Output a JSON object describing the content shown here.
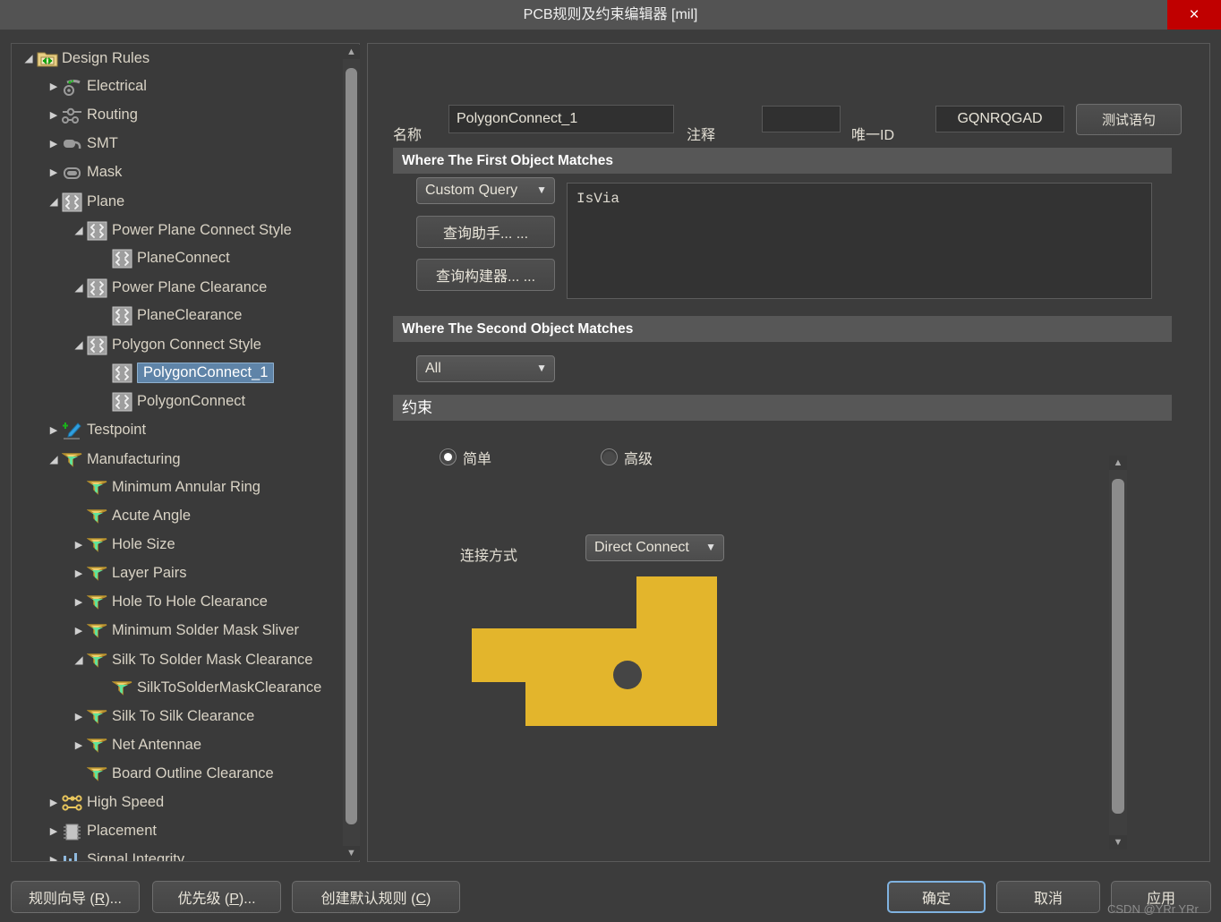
{
  "window": {
    "title": "PCB规则及约束编辑器 [mil]",
    "close_label": "×",
    "close_icon": "close-icon",
    "titlebar_bg": "#535353",
    "close_bg": "#c00000"
  },
  "tree": {
    "root_label": "Design Rules",
    "selected": "PolygonConnect_1",
    "items": [
      {
        "label": "Design Rules",
        "depth": 0,
        "arrow": "open",
        "icon": "folder-rules-icon"
      },
      {
        "label": "Electrical",
        "depth": 1,
        "arrow": "closed",
        "icon": "electrical-icon"
      },
      {
        "label": "Routing",
        "depth": 1,
        "arrow": "closed",
        "icon": "routing-icon"
      },
      {
        "label": "SMT",
        "depth": 1,
        "arrow": "closed",
        "icon": "smt-icon"
      },
      {
        "label": "Mask",
        "depth": 1,
        "arrow": "closed",
        "icon": "mask-icon"
      },
      {
        "label": "Plane",
        "depth": 1,
        "arrow": "open",
        "icon": "plane-icon"
      },
      {
        "label": "Power Plane Connect Style",
        "depth": 2,
        "arrow": "open",
        "icon": "plane-icon"
      },
      {
        "label": "PlaneConnect",
        "depth": 3,
        "arrow": "none",
        "icon": "plane-icon"
      },
      {
        "label": "Power Plane Clearance",
        "depth": 2,
        "arrow": "open",
        "icon": "plane-icon"
      },
      {
        "label": "PlaneClearance",
        "depth": 3,
        "arrow": "none",
        "icon": "plane-icon"
      },
      {
        "label": "Polygon Connect Style",
        "depth": 2,
        "arrow": "open",
        "icon": "plane-icon"
      },
      {
        "label": "PolygonConnect_1",
        "depth": 3,
        "arrow": "none",
        "icon": "plane-icon",
        "selected": true
      },
      {
        "label": "PolygonConnect",
        "depth": 3,
        "arrow": "none",
        "icon": "plane-icon"
      },
      {
        "label": "Testpoint",
        "depth": 1,
        "arrow": "closed",
        "icon": "testpoint-icon"
      },
      {
        "label": "Manufacturing",
        "depth": 1,
        "arrow": "open",
        "icon": "manufacturing-icon"
      },
      {
        "label": "Minimum Annular Ring",
        "depth": 2,
        "arrow": "none",
        "icon": "manufacturing-icon"
      },
      {
        "label": "Acute Angle",
        "depth": 2,
        "arrow": "none",
        "icon": "manufacturing-icon"
      },
      {
        "label": "Hole Size",
        "depth": 2,
        "arrow": "closed",
        "icon": "manufacturing-icon"
      },
      {
        "label": "Layer Pairs",
        "depth": 2,
        "arrow": "closed",
        "icon": "manufacturing-icon"
      },
      {
        "label": "Hole To Hole Clearance",
        "depth": 2,
        "arrow": "closed",
        "icon": "manufacturing-icon"
      },
      {
        "label": "Minimum Solder Mask Sliver",
        "depth": 2,
        "arrow": "closed",
        "icon": "manufacturing-icon"
      },
      {
        "label": "Silk To Solder Mask Clearance",
        "depth": 2,
        "arrow": "open",
        "icon": "manufacturing-icon"
      },
      {
        "label": "SilkToSolderMaskClearance",
        "depth": 3,
        "arrow": "none",
        "icon": "manufacturing-icon"
      },
      {
        "label": "Silk To Silk Clearance",
        "depth": 2,
        "arrow": "closed",
        "icon": "manufacturing-icon"
      },
      {
        "label": "Net Antennae",
        "depth": 2,
        "arrow": "closed",
        "icon": "manufacturing-icon"
      },
      {
        "label": "Board Outline Clearance",
        "depth": 2,
        "arrow": "none",
        "icon": "manufacturing-icon"
      },
      {
        "label": "High Speed",
        "depth": 1,
        "arrow": "closed",
        "icon": "highspeed-icon"
      },
      {
        "label": "Placement",
        "depth": 1,
        "arrow": "closed",
        "icon": "placement-icon"
      },
      {
        "label": "Signal Integrity",
        "depth": 1,
        "arrow": "closed",
        "icon": "signal-integrity-icon"
      }
    ]
  },
  "form": {
    "name_label": "名称",
    "name_value": "PolygonConnect_1",
    "comment_label": "注释",
    "comment_value": "",
    "unique_id_label": "唯一ID",
    "unique_id_value": "GQNRQGAD",
    "test_button": "测试语句"
  },
  "first_object": {
    "header": "Where The First Object Matches",
    "scope_value": "Custom Query",
    "query_helper_button": "查询助手... ...",
    "query_builder_button": "查询构建器... ...",
    "query_text": "IsVia"
  },
  "second_object": {
    "header": "Where The Second Object Matches",
    "scope_value": "All"
  },
  "constraints": {
    "header": "约束",
    "mode_simple": "简单",
    "mode_advanced": "高级",
    "selected_mode": "简单",
    "connect_style_label": "连接方式",
    "connect_style_value": "Direct Connect",
    "polygon_color": "#e3b52c",
    "hole_color": "#454545"
  },
  "footer": {
    "rule_wizard": "规则向导 (R)...",
    "rule_wizard_accel": "R",
    "priorities": "优先级 (P)...",
    "priorities_accel": "P",
    "create_default": "创建默认规则 (C)",
    "create_default_accel": "C",
    "ok": "确定",
    "cancel": "取消",
    "apply": "应用"
  },
  "watermark": "CSDN @YRr YRr"
}
